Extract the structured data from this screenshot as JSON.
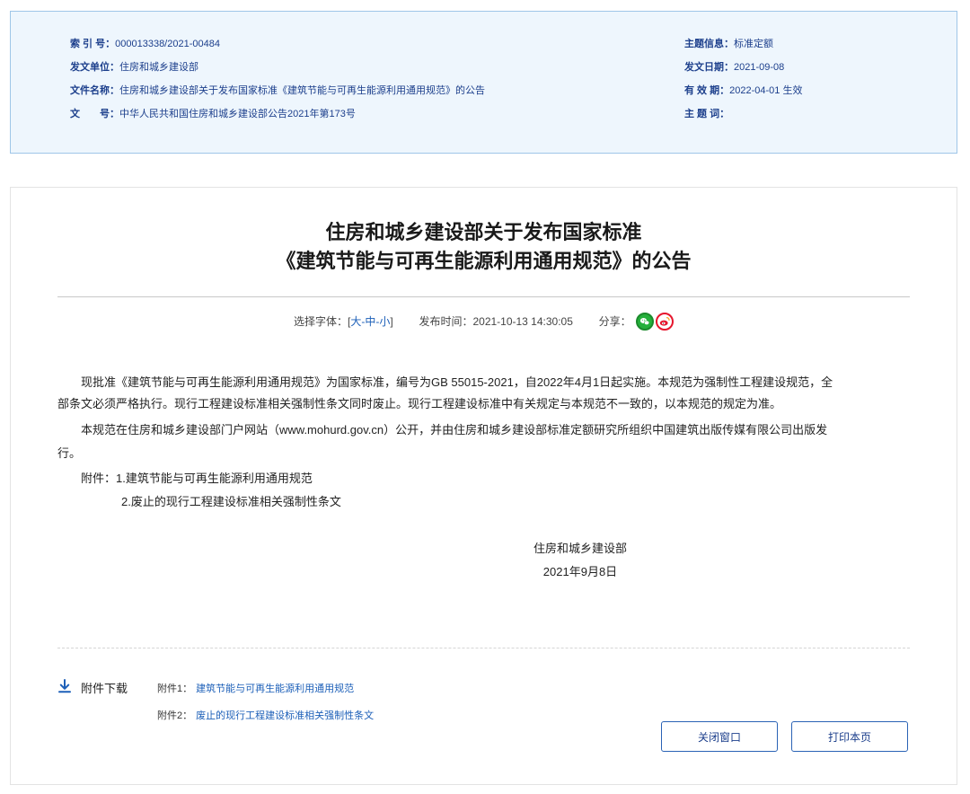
{
  "meta": {
    "index_label": "索 引 号：",
    "index_value": "000013338/2021-00484",
    "issuer_label": "发文单位：",
    "issuer_value": "住房和城乡建设部",
    "filename_label": "文件名称：",
    "filename_value": "住房和城乡建设部关于发布国家标准《建筑节能与可再生能源利用通用规范》的公告",
    "docnum_label": "文　　号：",
    "docnum_value": "中华人民共和国住房和城乡建设部公告2021年第173号",
    "topic_label": "主题信息：",
    "topic_value": "标准定额",
    "date_label": "发文日期：",
    "date_value": "2021-09-08",
    "validity_label": "有 效 期：",
    "validity_value": "2022-04-01 生效",
    "keyword_label": "主 题 词："
  },
  "article": {
    "title_line1": "住房和城乡建设部关于发布国家标准",
    "title_line2": "《建筑节能与可再生能源利用通用规范》的公告",
    "font_label": "选择字体：[",
    "font_large": "大",
    "font_medium": "中",
    "font_small": "小",
    "font_sep": "-",
    "font_close": "]",
    "publish_label": "发布时间：",
    "publish_time": "2021-10-13 14:30:05",
    "share_label": "分享：",
    "para1_line1": "现批准《建筑节能与可再生能源利用通用规范》为国家标准，编号为GB 55015-2021，自2022年4月1日起实施。本规范为强制性工程建设规范，全",
    "para1_line2": "部条文必须严格执行。现行工程建设标准相关强制性条文同时废止。现行工程建设标准中有关规定与本规范不一致的，以本规范的规定为准。",
    "para2_line1": "本规范在住房和城乡建设部门户网站（www.mohurd.gov.cn）公开，并由住房和城乡建设部标准定额研究所组织中国建筑出版传媒有限公司出版发",
    "para2_line2": "行。",
    "attach_label": "附件：",
    "attach_item1": "1.建筑节能与可再生能源利用通用规范",
    "attach_item2": "2.废止的现行工程建设标准相关强制性条文",
    "signature": "住房和城乡建设部",
    "sign_date": "2021年9月8日"
  },
  "downloads": {
    "heading": "附件下载",
    "items": [
      {
        "label": "附件1：",
        "link": "建筑节能与可再生能源利用通用规范"
      },
      {
        "label": "附件2：",
        "link": "废止的现行工程建设标准相关强制性条文"
      }
    ]
  },
  "buttons": {
    "close_label": "关闭窗口",
    "print_label": "打印本页"
  },
  "colors": {
    "link": "#1c5fb8",
    "meta_text": "#1c3f8c",
    "meta_bg": "#eef6fd",
    "wechat": "#25b03b",
    "weibo": "#e6162d"
  }
}
